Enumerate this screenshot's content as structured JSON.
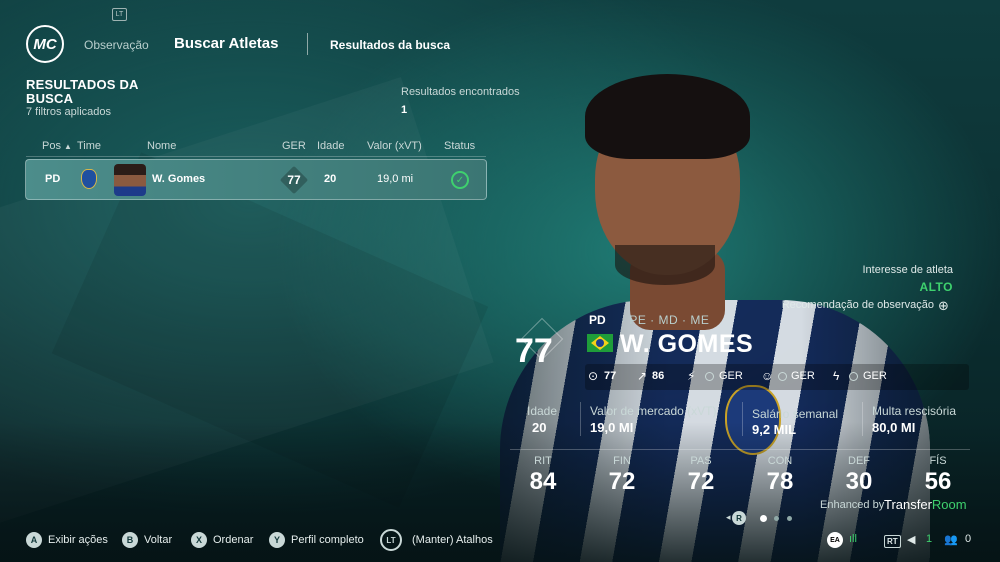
{
  "header": {
    "logo_text": "MC",
    "lt_badge": "LT",
    "nav_observacao": "Observação",
    "nav_buscar": "Buscar Atletas",
    "nav_resultados": "Resultados da busca"
  },
  "results": {
    "title": "RESULTADOS DA BUSCA",
    "filters": "7 filtros aplicados",
    "found_label": "Resultados encontrados",
    "found_value": "1",
    "columns": [
      "Pos",
      "Time",
      "Nome",
      "GER",
      "Idade",
      "Valor (xVT)",
      "Status"
    ],
    "sort_arrow": "▲",
    "rows": [
      {
        "pos": "PD",
        "name": "W. Gomes",
        "ger": "77",
        "idade": "20",
        "valor": "19,0 mi",
        "status_icon": "check-circle-icon"
      }
    ]
  },
  "scouting": {
    "interest_label": "Interesse de atleta",
    "interest_value": "ALTO",
    "recommendation_label": "Recomendação de observação",
    "recommendation_icon": "⊕"
  },
  "player": {
    "overall": "77",
    "main_position": "PD",
    "alt_positions": "· PE · MD · ME",
    "name": "W. GOMES",
    "nationality_flag": "brazil-flag-icon",
    "chips": {
      "ovr": "77",
      "potential": "86",
      "ger1": "GER",
      "ger2": "GER",
      "ger3": "GER"
    },
    "info": {
      "idade_label": "Idade",
      "idade_value": "20",
      "mercado_label": "Valor de mercado (xVT)",
      "mercado_value": "19,0 MI",
      "salario_label": "Salário semanal",
      "salario_value": "9,2 MIL",
      "rescisao_label": "Multa rescisória",
      "rescisao_value": "80,0 MI"
    },
    "stats": [
      {
        "label": "RIT",
        "value": "84"
      },
      {
        "label": "FIN",
        "value": "72"
      },
      {
        "label": "PAS",
        "value": "72"
      },
      {
        "label": "CON",
        "value": "78"
      },
      {
        "label": "DEF",
        "value": "30"
      },
      {
        "label": "FÍS",
        "value": "56"
      }
    ],
    "enhanced_by": "Enhanced by",
    "brand_a": "Transfer",
    "brand_b": "Room"
  },
  "pager": {
    "button": "R",
    "current_page": 1,
    "total_pages": 3
  },
  "controls": [
    {
      "key": "A",
      "label": "Exibir ações"
    },
    {
      "key": "B",
      "label": "Voltar"
    },
    {
      "key": "X",
      "label": "Ordenar"
    },
    {
      "key": "Y",
      "label": "Perfil completo"
    },
    {
      "key": "LT",
      "label": "(Manter) Atalhos"
    }
  ],
  "system": {
    "ea": "EA",
    "rt": "RT",
    "rt_count": "1",
    "friends": "0"
  },
  "colors": {
    "accent_green": "#3ed16e",
    "row_highlight": "#4c8d8b",
    "background": "#0f3c3e"
  }
}
